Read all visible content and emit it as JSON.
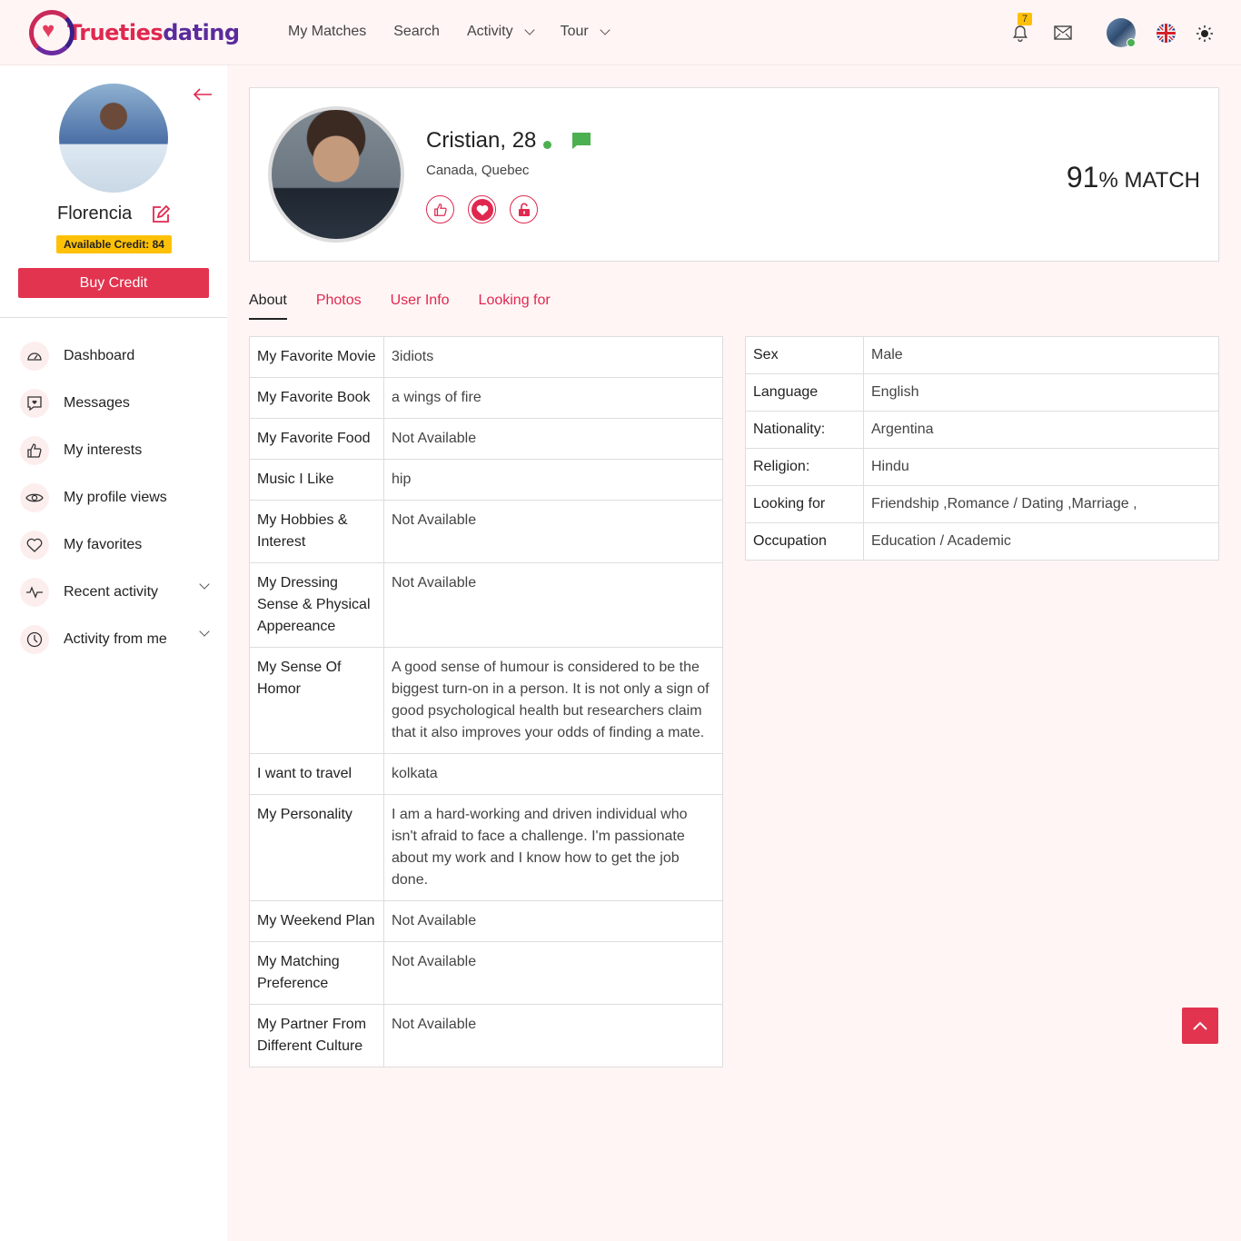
{
  "brand": {
    "part1": "Trueties",
    "part2": "dating"
  },
  "nav": [
    {
      "label": "My Matches"
    },
    {
      "label": "Search"
    },
    {
      "label": "Activity",
      "dropdown": true
    },
    {
      "label": "Tour",
      "dropdown": true
    }
  ],
  "header": {
    "notification_count": "7"
  },
  "sidebar": {
    "user_name": "Florencia",
    "credit": "Available Credit: 84",
    "buy_label": "Buy Credit",
    "menu": [
      {
        "label": "Dashboard",
        "icon": "dashboard-icon"
      },
      {
        "label": "Messages",
        "icon": "message-icon"
      },
      {
        "label": "My interests",
        "icon": "thumbs-up-icon"
      },
      {
        "label": "My profile views",
        "icon": "eye-icon"
      },
      {
        "label": "My favorites",
        "icon": "heart-icon"
      },
      {
        "label": "Recent activity",
        "icon": "activity-icon"
      },
      {
        "label": "Activity from me",
        "icon": "clock-icon"
      }
    ]
  },
  "profile": {
    "name": "Cristian, 28",
    "location": "Canada, Quebec",
    "match_percent": "91",
    "match_label": "% MATCH"
  },
  "tabs": [
    {
      "label": "About"
    },
    {
      "label": "Photos"
    },
    {
      "label": "User Info"
    },
    {
      "label": "Looking for"
    }
  ],
  "about": [
    {
      "k": "My Favorite Movie",
      "v": "3idiots"
    },
    {
      "k": "My Favorite Book",
      "v": "a wings of fire"
    },
    {
      "k": "My Favorite Food",
      "v": "Not Available"
    },
    {
      "k": "Music I Like",
      "v": "hip"
    },
    {
      "k": "My Hobbies & Interest",
      "v": "Not Available"
    },
    {
      "k": "My Dressing Sense & Physical Appereance",
      "v": "Not Available"
    },
    {
      "k": "My Sense Of Homor",
      "v": "A good sense of humour is considered to be the biggest turn-on in a person. It is not only a sign of good psychological health but researchers claim that it also improves your odds of finding a mate."
    },
    {
      "k": "I want to travel",
      "v": "kolkata"
    },
    {
      "k": "My Personality",
      "v": "I am a hard-working and driven individual who isn't afraid to face a challenge. I'm passionate about my work and I know how to get the job done."
    },
    {
      "k": "My Weekend Plan",
      "v": "Not Available"
    },
    {
      "k": "My Matching Preference",
      "v": "Not Available"
    },
    {
      "k": "My Partner From Different Culture",
      "v": "Not Available"
    }
  ],
  "info": [
    {
      "k": "Sex",
      "v": "Male"
    },
    {
      "k": "Language",
      "v": "English"
    },
    {
      "k": "Nationality:",
      "v": "Argentina"
    },
    {
      "k": "Religion:",
      "v": "Hindu"
    },
    {
      "k": "Looking for",
      "v": "Friendship ,Romance / Dating ,Marriage ,"
    },
    {
      "k": "Occupation",
      "v": "Education / Academic"
    }
  ],
  "colors": {
    "accent": "#e0284f",
    "credit": "#ffc107",
    "online": "#4caf50"
  }
}
